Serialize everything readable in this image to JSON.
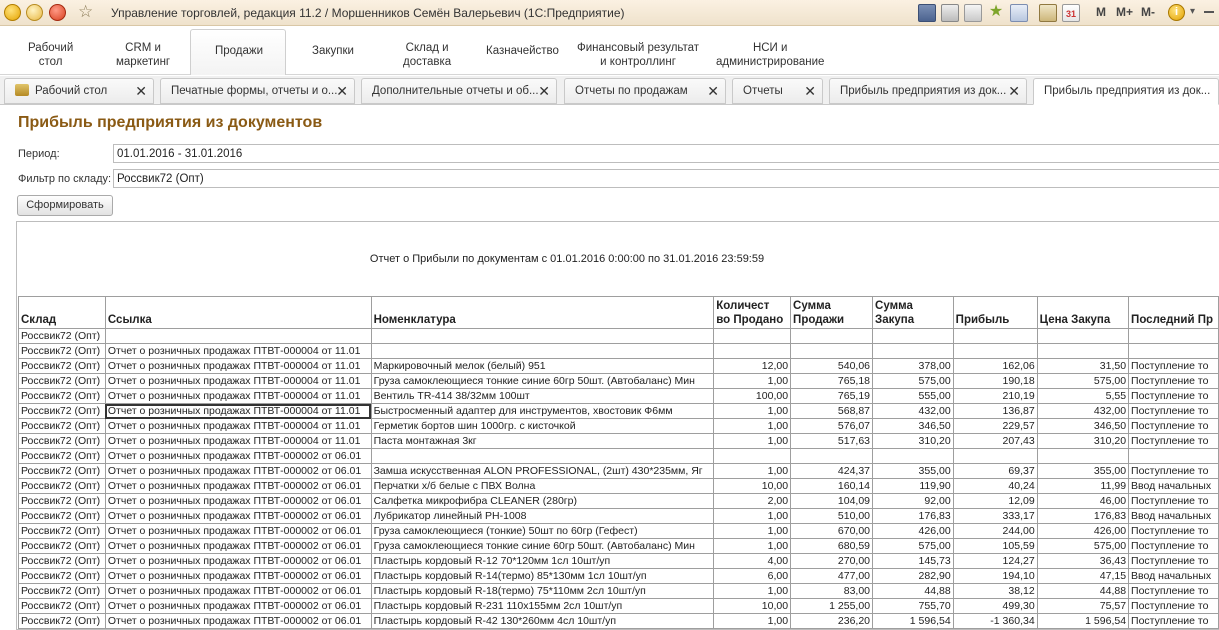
{
  "window": {
    "title": "Управление торговлей, редакция 11.2 / Моршенников Семён Валерьевич  (1С:Предприятие)",
    "memory_buttons": [
      "M",
      "M+",
      "M-"
    ],
    "calendar_day": "31",
    "info_label": "i"
  },
  "sections": [
    {
      "label": "Рабочий\nстол"
    },
    {
      "label": "CRM и\nмаркетинг"
    },
    {
      "label": "Продажи",
      "active": true
    },
    {
      "label": "Закупки"
    },
    {
      "label": "Склад и\nдоставка"
    },
    {
      "label": "Казначейство"
    },
    {
      "label": "Финансовый результат\nи контроллинг"
    },
    {
      "label": "НСИ и\nадминистрирование"
    }
  ],
  "tabs": [
    {
      "label": "Рабочий стол"
    },
    {
      "label": "Печатные формы, отчеты и о..."
    },
    {
      "label": "Дополнительные отчеты и об..."
    },
    {
      "label": "Отчеты по продажам"
    },
    {
      "label": "Отчеты"
    },
    {
      "label": "Прибыль предприятия из док..."
    },
    {
      "label": "Прибыль предприятия из док...",
      "active": true
    }
  ],
  "form": {
    "title": "Прибыль предприятия из документов",
    "period_label": "Период:",
    "period_value": "01.01.2016 - 31.01.2016",
    "warehouse_label": "Фильтр по складу:",
    "warehouse_value": "Россвик72 (Опт)",
    "generate_button": "Сформировать"
  },
  "report": {
    "heading": "Отчет о Прибыли по документам с 01.01.2016 0:00:00 по 31.01.2016 23:59:59",
    "columns": [
      "Склад",
      "Ссылка",
      "Номенклатура",
      "Количест\nво Продано",
      "Сумма\nПродажи",
      "Сумма\nЗакупа",
      "Прибыль",
      "Цена Закупа",
      "Последний Пр"
    ],
    "rows": [
      [
        "Россвик72 (Опт)",
        "",
        "",
        "",
        "",
        "",
        "",
        "",
        ""
      ],
      [
        "Россвик72 (Опт)",
        "Отчет о розничных продажах ПТВТ-000004 от 11.01",
        "",
        "",
        "",
        "",
        "",
        "",
        ""
      ],
      [
        "Россвик72 (Опт)",
        "Отчет о розничных продажах ПТВТ-000004 от 11.01",
        "Маркировочный мелок (белый)  951",
        "12,00",
        "540,06",
        "378,00",
        "162,06",
        "31,50",
        "Поступление то"
      ],
      [
        "Россвик72 (Опт)",
        "Отчет о розничных продажах ПТВТ-000004 от 11.01",
        "Груза самоклеющиеся тонкие синие 60гр 50шт. (Автобаланс) Мин",
        "1,00",
        "765,18",
        "575,00",
        "190,18",
        "575,00",
        "Поступление то"
      ],
      [
        "Россвик72 (Опт)",
        "Отчет о розничных продажах ПТВТ-000004 от 11.01",
        "Вентиль TR-414 38/32мм 100шт",
        "100,00",
        "765,19",
        "555,00",
        "210,19",
        "5,55",
        "Поступление то"
      ],
      [
        "Россвик72 (Опт)",
        "Отчет о розничных продажах ПТВТ-000004 от 11.01",
        "Быстросменный адаптер для инструментов, хвостовик Ф6мм",
        "1,00",
        "568,87",
        "432,00",
        "136,87",
        "432,00",
        "Поступление то"
      ],
      [
        "Россвик72 (Опт)",
        "Отчет о розничных продажах ПТВТ-000004 от 11.01",
        "Герметик бортов шин 1000гр. с кисточкой",
        "1,00",
        "576,07",
        "346,50",
        "229,57",
        "346,50",
        "Поступление то"
      ],
      [
        "Россвик72 (Опт)",
        "Отчет о розничных продажах ПТВТ-000004 от 11.01",
        "Паста монтажная  3кг",
        "1,00",
        "517,63",
        "310,20",
        "207,43",
        "310,20",
        "Поступление то"
      ],
      [
        "Россвик72 (Опт)",
        "Отчет о розничных продажах ПТВТ-000002 от 06.01",
        "",
        "",
        "",
        "",
        "",
        "",
        ""
      ],
      [
        "Россвик72 (Опт)",
        "Отчет о розничных продажах ПТВТ-000002 от 06.01",
        "Замша искусственная ALON PROFESSIONAL, (2шт) 430*235мм, Яг",
        "1,00",
        "424,37",
        "355,00",
        "69,37",
        "355,00",
        "Поступление то"
      ],
      [
        "Россвик72 (Опт)",
        "Отчет о розничных продажах ПТВТ-000002 от 06.01",
        "Перчатки х/б белые с ПВХ Волна",
        "10,00",
        "160,14",
        "119,90",
        "40,24",
        "11,99",
        "Ввод начальных"
      ],
      [
        "Россвик72 (Опт)",
        "Отчет о розничных продажах ПТВТ-000002 от 06.01",
        "Салфетка микрофибра CLEANER (280гр)",
        "2,00",
        "104,09",
        "92,00",
        "12,09",
        "46,00",
        "Поступление то"
      ],
      [
        "Россвик72 (Опт)",
        "Отчет о розничных продажах ПТВТ-000002 от 06.01",
        "Лубрикатор линейный PH-1008",
        "1,00",
        "510,00",
        "176,83",
        "333,17",
        "176,83",
        "Ввод начальных"
      ],
      [
        "Россвик72 (Опт)",
        "Отчет о розничных продажах ПТВТ-000002 от 06.01",
        "Груза самоклеющиеся (тонкие)  50шт по 60гр (Гефест)",
        "1,00",
        "670,00",
        "426,00",
        "244,00",
        "426,00",
        "Поступление то"
      ],
      [
        "Россвик72 (Опт)",
        "Отчет о розничных продажах ПТВТ-000002 от 06.01",
        "Груза самоклеющиеся тонкие синие 60гр 50шт. (Автобаланс) Мин",
        "1,00",
        "680,59",
        "575,00",
        "105,59",
        "575,00",
        "Поступление то"
      ],
      [
        "Россвик72 (Опт)",
        "Отчет о розничных продажах ПТВТ-000002 от 06.01",
        "Пластырь кордовый R-12 70*120мм 1сл 10шт/уп",
        "4,00",
        "270,00",
        "145,73",
        "124,27",
        "36,43",
        "Поступление то"
      ],
      [
        "Россвик72 (Опт)",
        "Отчет о розничных продажах ПТВТ-000002 от 06.01",
        "Пластырь кордовый R-14(термо) 85*130мм 1сл 10шт/уп",
        "6,00",
        "477,00",
        "282,90",
        "194,10",
        "47,15",
        "Ввод начальных"
      ],
      [
        "Россвик72 (Опт)",
        "Отчет о розничных продажах ПТВТ-000002 от 06.01",
        "Пластырь кордовый R-18(термо) 75*110мм 2сл 10шт/уп",
        "1,00",
        "83,00",
        "44,88",
        "38,12",
        "44,88",
        "Поступление то"
      ],
      [
        "Россвик72 (Опт)",
        "Отчет о розничных продажах ПТВТ-000002 от 06.01",
        "Пластырь кордовый R-231  110х155мм 2сл  10шт/уп",
        "10,00",
        "1 255,00",
        "755,70",
        "499,30",
        "75,57",
        "Поступление то"
      ],
      [
        "Россвик72 (Опт)",
        "Отчет о розничных продажах ПТВТ-000002 от 06.01",
        "Пластырь кордовый R-42  130*260мм  4сл 10шт/уп",
        "1,00",
        "236,20",
        "1 596,54",
        "-1 360,34",
        "1 596,54",
        "Поступление то"
      ]
    ]
  }
}
